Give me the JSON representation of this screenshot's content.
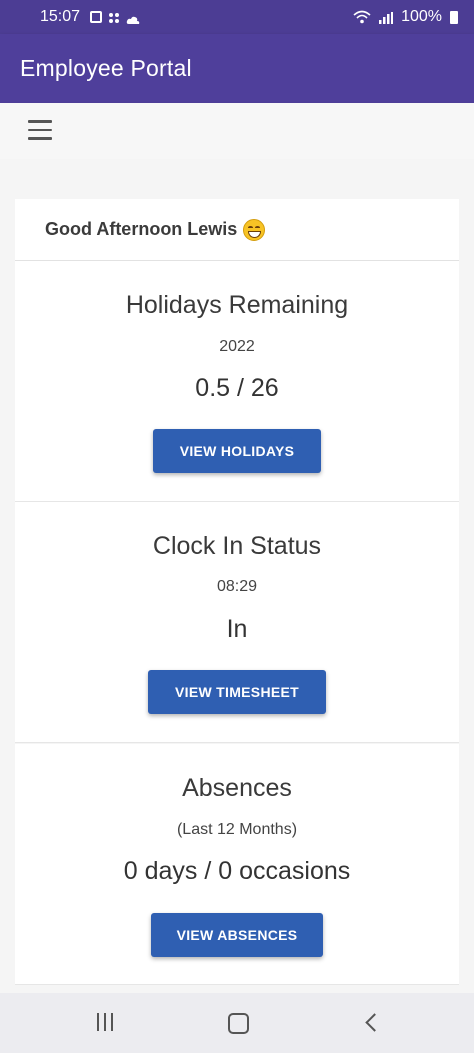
{
  "status_bar": {
    "time": "15:07",
    "battery": "100%",
    "icons": [
      "notification-icon",
      "apps-icon",
      "cloud-icon",
      "wifi-icon",
      "signal-icon",
      "battery-icon"
    ]
  },
  "app": {
    "title": "Employee Portal",
    "colors": {
      "appbar": "#4f3f9b",
      "button": "#2f5fb2"
    }
  },
  "toolbar": {
    "menu_icon": "hamburger-menu-icon"
  },
  "greeting": {
    "text": "Good Afternoon Lewis",
    "emoji": "grinning-face-icon"
  },
  "cards": {
    "holidays": {
      "title": "Holidays Remaining",
      "subtitle": "2022",
      "value": "0.5 / 26",
      "button": "VIEW HOLIDAYS"
    },
    "clock": {
      "title": "Clock In Status",
      "subtitle": "08:29",
      "value": "In",
      "button": "VIEW TIMESHEET"
    },
    "absences": {
      "title": "Absences",
      "subtitle": "(Last 12 Months)",
      "value": "0 days / 0 occasions",
      "button": "VIEW ABSENCES"
    }
  },
  "nav_bar": {
    "icons": [
      "recent-apps-icon",
      "home-icon",
      "back-icon"
    ]
  }
}
